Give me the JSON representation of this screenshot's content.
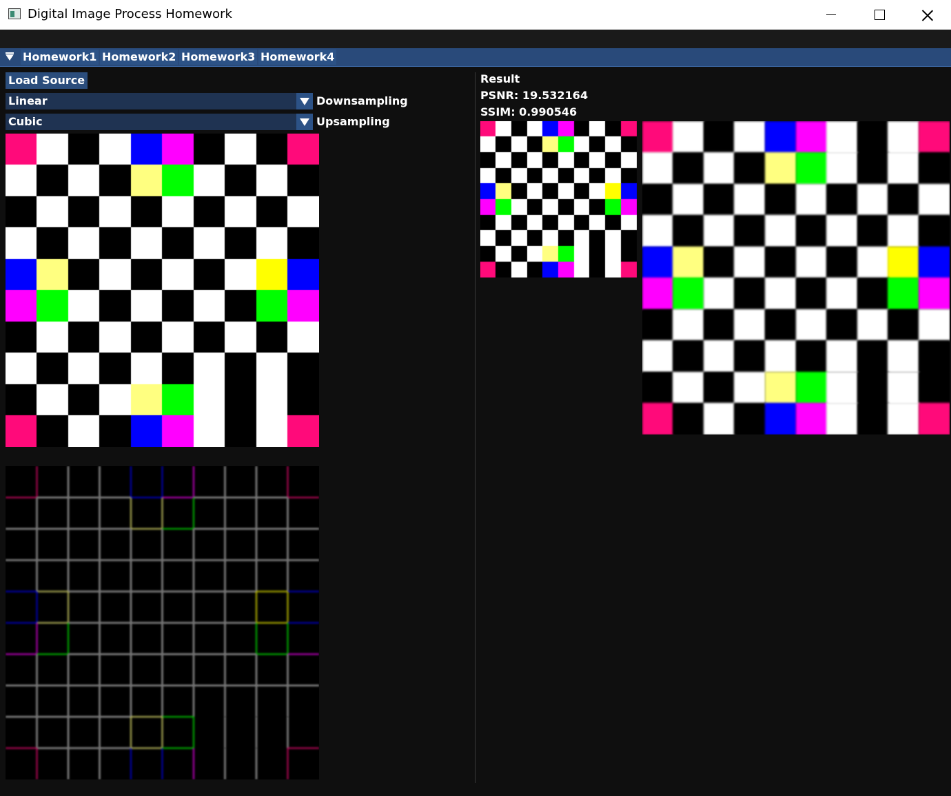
{
  "window": {
    "title": "Digital Image Process Homework"
  },
  "tabs": [
    {
      "label": "Homework1",
      "active": false
    },
    {
      "label": "Homework2",
      "active": false
    },
    {
      "label": "Homework3",
      "active": false
    },
    {
      "label": "Homework4",
      "active": true
    }
  ],
  "controls": {
    "load_source_label": "Load Source",
    "downsampling": {
      "value": "Linear",
      "label": "Downsampling"
    },
    "upsampling": {
      "value": "Cubic",
      "label": "Upsampling"
    }
  },
  "result": {
    "heading": "Result",
    "psnr_text": "PSNR: 19.532164",
    "ssim_text": "SSIM: 0.990546"
  },
  "colors": {
    "pink": "#ff0a7a",
    "blue": "#0000ff",
    "magenta": "#ff00ff",
    "yellow_light": "#ffff80",
    "yellow": "#ffff00",
    "green": "#00ff00",
    "white": "#ffffff",
    "black": "#000000"
  },
  "images": {
    "source_grid": [
      "PWKWBMKWKP",
      "WKWKLGWKWK",
      "KWKWKWKWKW",
      "WKWKWKWKWK",
      "BLKWKWKWYB",
      "MGWKWKWKGM",
      "KWKWKWKWKW",
      "WKWKWKWKWK",
      "KWKWLGWKWK",
      "PKWKBMWKWP"
    ],
    "downsampled_grid": [
      "PWKWBMKWKP",
      "WKWKLGWKWK",
      "KWKWKWKWKW",
      "WKWKWKWKWK",
      "BLKWKWKWYB",
      "MGWKWKWKGM",
      "KWKWKWKWKW",
      "WKWKWKWKWK",
      "KWKWLGWKWK",
      "PKWKBMWKWP"
    ],
    "upsampled_grid": [
      "PWKWBMWKWP",
      "WKWKLGWKWK",
      "KWKWKWKWKW",
      "WKWKWKWKWK",
      "BLKWKWKWYB",
      "MGWKWKWKGM",
      "KWKWKWKWKW",
      "WKWKWKWKWK",
      "KWKWLGWKWK",
      "PKWKBMWKWP"
    ]
  }
}
